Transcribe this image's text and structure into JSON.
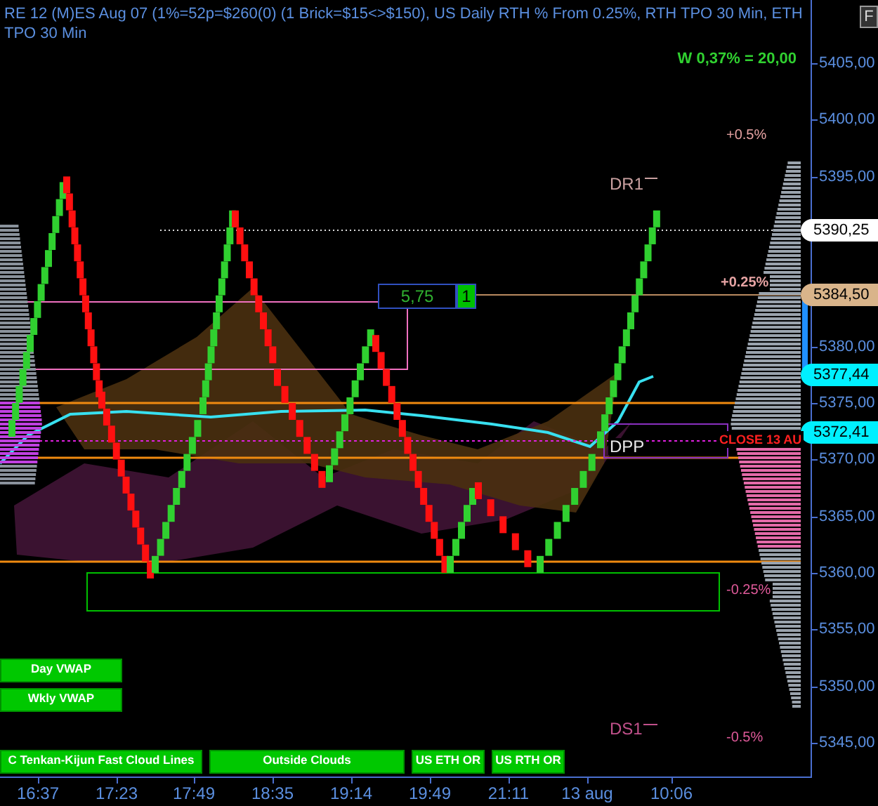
{
  "header": {
    "title": "RE 12 (M)ES Aug 07 (1%=52p=$260(0) (1 Brick=$15<>$150), US Daily RTH % From 0.25%, RTH TPO 30 Min, ETH TPO 30 Min",
    "stat": "W 0,37% = 20,00"
  },
  "corner_button": "F",
  "price_axis": [
    "5405,00",
    "5400,00",
    "5395,00",
    "5380,00",
    "5375,00",
    "5370,00",
    "5365,00",
    "5360,00",
    "5355,00",
    "5350,00",
    "5345,00"
  ],
  "price_tags": [
    {
      "text": "5390,25",
      "color": "#ffffff"
    },
    {
      "text": "5384,50",
      "color": "#d9b48a"
    },
    {
      "text": "5377,44",
      "color": "#00f0ff"
    },
    {
      "text": "5372,41",
      "color": "#00f0ff"
    }
  ],
  "chart_labels": [
    {
      "text": "+0.5%",
      "color": "#e6a3a3"
    },
    {
      "text": "DR1",
      "color": "#c9a0a0"
    },
    {
      "text": "+0.25%",
      "color": "#e6a3a3"
    },
    {
      "text": "DPP",
      "color": "#e8e8e8"
    },
    {
      "text": "CLOSE 13 AU",
      "color": "#ff2020"
    },
    {
      "text": "-0.25%",
      "color": "#e05a9a"
    },
    {
      "text": "DS1",
      "color": "#c0508a"
    },
    {
      "text": "-0.5%",
      "color": "#e05a9a"
    }
  ],
  "brick_box": {
    "value": "5,75",
    "count": "1"
  },
  "side_buttons": [
    "Day VWAP",
    "Wkly VWAP"
  ],
  "toolbar_buttons": [
    "C Tenkan-Kijun Fast Cloud Lines",
    "Outside Clouds",
    "US ETH OR",
    "US RTH OR"
  ],
  "time_axis": [
    "16:37",
    "17:23",
    "17:49",
    "18:35",
    "19:14",
    "19:49",
    "21:11",
    "13 aug",
    "10:06"
  ]
}
